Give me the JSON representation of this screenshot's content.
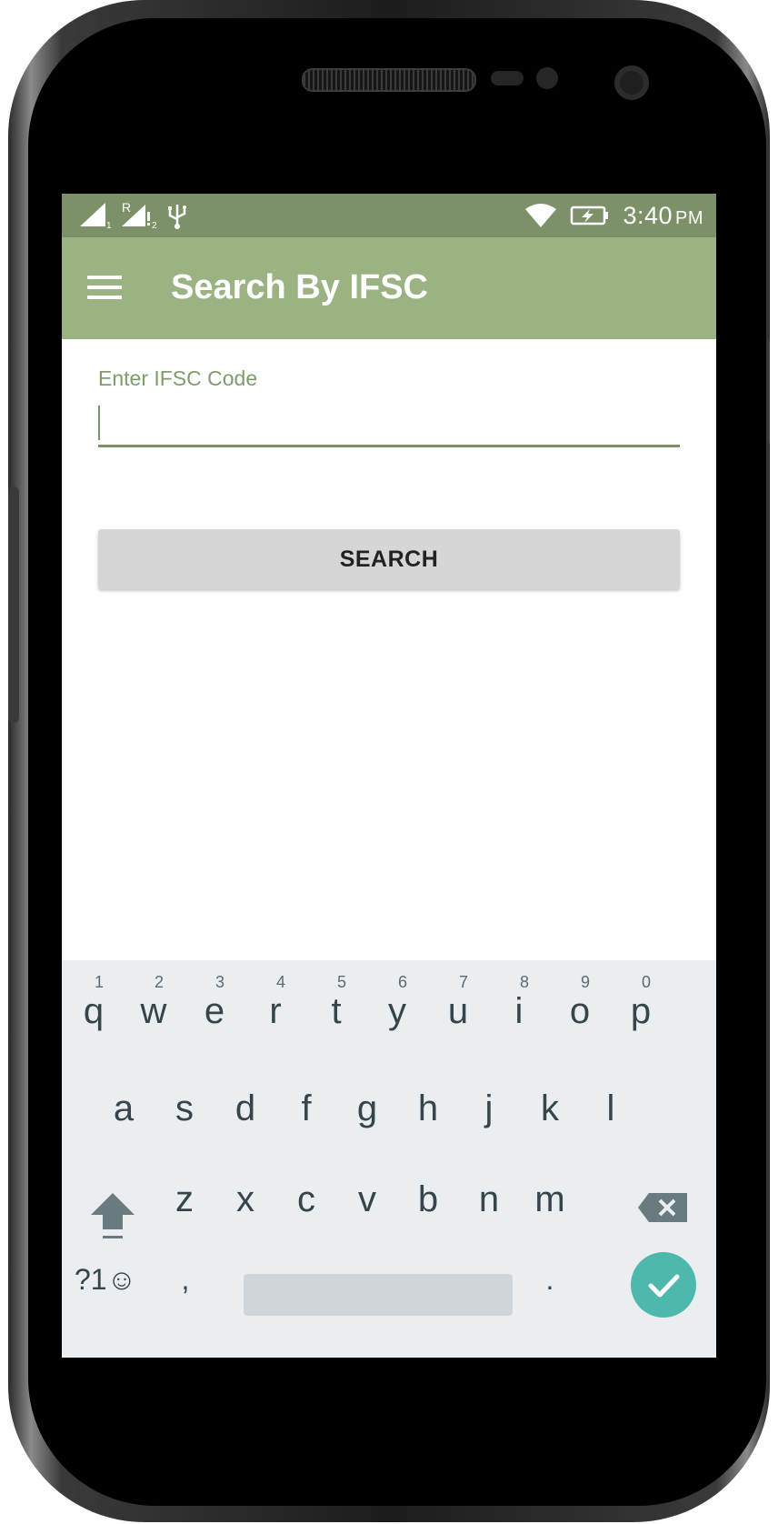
{
  "status_bar": {
    "time": "3:40",
    "ampm": "PM",
    "sim1_label": "1",
    "sim2_label": "2",
    "roaming_label": "R",
    "icons": [
      "signal-sim1-icon",
      "signal-sim2-roaming-icon",
      "usb-icon",
      "wifi-icon",
      "battery-charging-icon"
    ]
  },
  "app_bar": {
    "title": "Search By IFSC",
    "menu_icon": "hamburger-menu-icon"
  },
  "form": {
    "ifsc_label": "Enter IFSC Code",
    "ifsc_value": "",
    "search_button": "SEARCH"
  },
  "keyboard": {
    "row1": [
      {
        "key": "q",
        "hint": "1"
      },
      {
        "key": "w",
        "hint": "2"
      },
      {
        "key": "e",
        "hint": "3"
      },
      {
        "key": "r",
        "hint": "4"
      },
      {
        "key": "t",
        "hint": "5"
      },
      {
        "key": "y",
        "hint": "6"
      },
      {
        "key": "u",
        "hint": "7"
      },
      {
        "key": "i",
        "hint": "8"
      },
      {
        "key": "o",
        "hint": "9"
      },
      {
        "key": "p",
        "hint": "0"
      }
    ],
    "row2": [
      "a",
      "s",
      "d",
      "f",
      "g",
      "h",
      "j",
      "k",
      "l"
    ],
    "row3": [
      "z",
      "x",
      "c",
      "v",
      "b",
      "n",
      "m"
    ],
    "symbols_key": "?1☺",
    "comma_key": ",",
    "period_key": ".",
    "shift_icon": "shift-arrow-icon",
    "backspace_icon": "backspace-icon",
    "done_icon": "checkmark-icon"
  },
  "colors": {
    "status_bar": "#7c9168",
    "app_bar": "#9bb383",
    "accent": "#7c9168",
    "done_key": "#4eb8ad"
  }
}
